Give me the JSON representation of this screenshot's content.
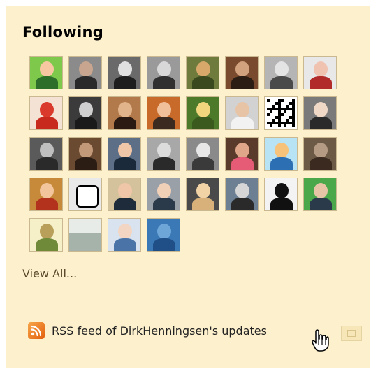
{
  "following": {
    "title": "Following",
    "view_all_label": "View All...",
    "avatars": [
      {
        "name": "avatar-cartoon-green",
        "bg": "#7ec84b",
        "skin": "#f6c7a0",
        "shirt": "#2d6e2a"
      },
      {
        "name": "avatar-person-2",
        "bg": "#8b8b8b",
        "skin": "#c7a58e",
        "shirt": "#2a2a2a"
      },
      {
        "name": "avatar-person-3",
        "bg": "#6a6a6a",
        "skin": "#e0e0e0",
        "shirt": "#1e1e1e"
      },
      {
        "name": "avatar-person-4",
        "bg": "#9a9a9a",
        "skin": "#d8d8d8",
        "shirt": "#303030"
      },
      {
        "name": "avatar-person-5",
        "bg": "#6f7a3d",
        "skin": "#d8a86a",
        "shirt": "#3b4a1e"
      },
      {
        "name": "avatar-person-6",
        "bg": "#7a4a2e",
        "skin": "#d2a27e",
        "shirt": "#2b1d14"
      },
      {
        "name": "avatar-person-7",
        "bg": "#b5b5b5",
        "skin": "#e4e4e4",
        "shirt": "#4a4a4a"
      },
      {
        "name": "avatar-person-8",
        "bg": "#e8e8e8",
        "skin": "#f0c2b0",
        "shirt": "#b22b2b"
      },
      {
        "name": "avatar-red-figure",
        "bg": "#f4e2d5",
        "skin": "#d93a2b",
        "shirt": "#c92a1e"
      },
      {
        "name": "avatar-person-10",
        "bg": "#3b3b3b",
        "skin": "#cfcfcf",
        "shirt": "#1a1a1a"
      },
      {
        "name": "avatar-person-11",
        "bg": "#b27a4a",
        "skin": "#e2b48c",
        "shirt": "#2a1a12"
      },
      {
        "name": "avatar-person-12",
        "bg": "#c86a2a",
        "skin": "#f0c09a",
        "shirt": "#3a2a20"
      },
      {
        "name": "avatar-person-13",
        "bg": "#4d7a2a",
        "skin": "#f2d67e",
        "shirt": "#3a5a1e"
      },
      {
        "name": "avatar-person-14",
        "bg": "#d2d2d2",
        "skin": "#e8c4a6",
        "shirt": "#f2f2f2"
      },
      {
        "name": "avatar-qr-code",
        "bg": "#ffffff",
        "skin": "#000000",
        "shirt": "#000000"
      },
      {
        "name": "avatar-person-16",
        "bg": "#7a7a7a",
        "skin": "#f0d8c6",
        "shirt": "#2a2a2a"
      },
      {
        "name": "avatar-person-17",
        "bg": "#5a5a5a",
        "skin": "#bfbfbf",
        "shirt": "#2a2a2a"
      },
      {
        "name": "avatar-person-18",
        "bg": "#6b4a32",
        "skin": "#c29a7a",
        "shirt": "#2b1d14"
      },
      {
        "name": "avatar-person-19",
        "bg": "#5c6f86",
        "skin": "#f0c6a8",
        "shirt": "#1a2a3a"
      },
      {
        "name": "avatar-person-20",
        "bg": "#a8a8a8",
        "skin": "#dcdcdc",
        "shirt": "#2a2a2a"
      },
      {
        "name": "avatar-person-21",
        "bg": "#8a8a8a",
        "skin": "#e7e7e7",
        "shirt": "#3a3a3a"
      },
      {
        "name": "avatar-person-22",
        "bg": "#5a3a2a",
        "skin": "#e0a68a",
        "shirt": "#e65c77"
      },
      {
        "name": "avatar-cartoon-cap",
        "bg": "#b7e3f5",
        "skin": "#f7c27a",
        "shirt": "#2d6fb3"
      },
      {
        "name": "avatar-person-24",
        "bg": "#6c5a46",
        "skin": "#b69b84",
        "shirt": "#3a2a20"
      },
      {
        "name": "avatar-person-25",
        "bg": "#c78a3b",
        "skin": "#f3c59d",
        "shirt": "#b3321e"
      },
      {
        "name": "avatar-logo-ig",
        "bg": "#e9e9e9",
        "skin": "#ffffff",
        "shirt": "#000000"
      },
      {
        "name": "avatar-person-27",
        "bg": "#d4c29c",
        "skin": "#f0c6a8",
        "shirt": "#1e2b3a"
      },
      {
        "name": "avatar-person-28",
        "bg": "#9aa0a8",
        "skin": "#f1d0b8",
        "shirt": "#2a3a4a"
      },
      {
        "name": "avatar-dog",
        "bg": "#4a4a4a",
        "skin": "#f2d3a6",
        "shirt": "#d7b07a"
      },
      {
        "name": "avatar-person-30",
        "bg": "#6d7f92",
        "skin": "#d6d6d6",
        "shirt": "#2a2a2a"
      },
      {
        "name": "avatar-silhouette-wings",
        "bg": "#f3f3f3",
        "skin": "#111111",
        "shirt": "#111111"
      },
      {
        "name": "avatar-person-32",
        "bg": "#4aa84a",
        "skin": "#e8c4a6",
        "shirt": "#2a3a4a"
      },
      {
        "name": "avatar-moose-drawing",
        "bg": "#f5f0c7",
        "skin": "#b9a05a",
        "shirt": "#6f8b3a"
      },
      {
        "name": "avatar-landscape",
        "bg": "#d7ddd9",
        "skin": "#a6b3aa",
        "shirt": "#7c8b83"
      },
      {
        "name": "avatar-person-35",
        "bg": "#d9e3ef",
        "skin": "#f2d5c2",
        "shirt": "#4a74a8"
      },
      {
        "name": "avatar-blue-photo",
        "bg": "#3a79b6",
        "skin": "#6fa6d8",
        "shirt": "#1f4f86"
      }
    ]
  },
  "rss": {
    "label": "RSS feed of DirkHenningsen's updates"
  },
  "colors": {
    "panel_bg": "#fdf0cd",
    "panel_border": "#d8b56a",
    "link_text": "#222222",
    "muted_link_text": "#5b4a2b",
    "rss_orange": "#e3600d"
  },
  "icons": {
    "rss": "rss-icon",
    "cursor": "hand-pointer-icon"
  }
}
